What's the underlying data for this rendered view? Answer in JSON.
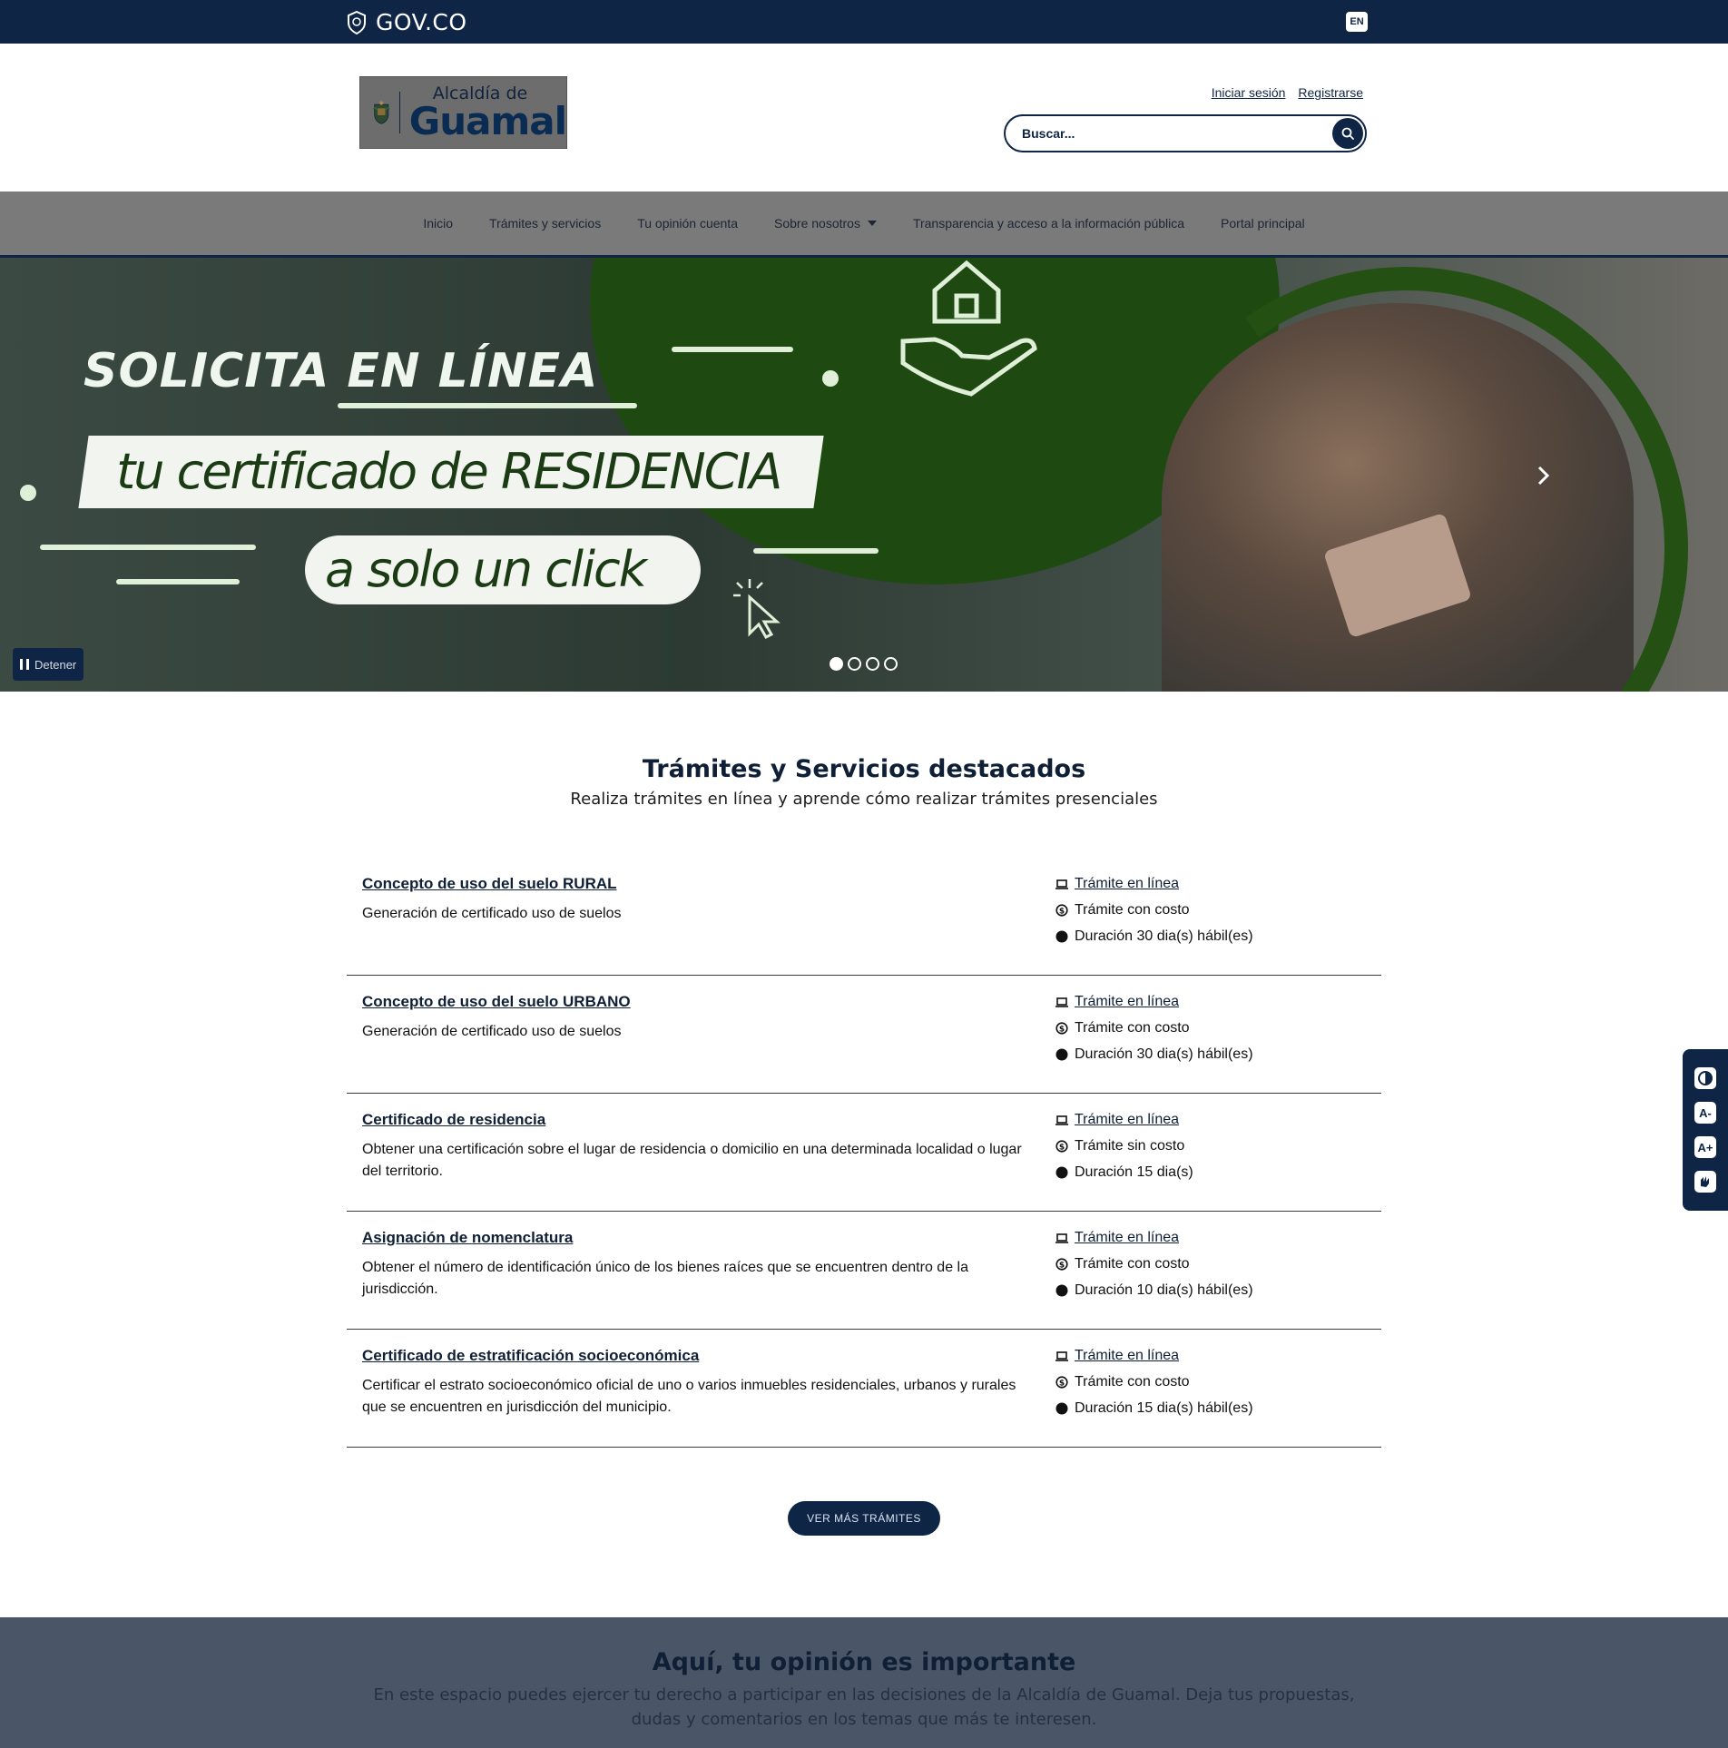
{
  "govbar": {
    "logo_text": "GOV.CO",
    "lang": "EN"
  },
  "header": {
    "brand_line1": "Alcaldía de",
    "brand_line2": "Guamal",
    "login": "Iniciar sesión",
    "register": "Registrarse",
    "search_placeholder": "Buscar..."
  },
  "nav": {
    "items": [
      "Inicio",
      "Trámites y servicios",
      "Tu opinión cuenta",
      "Sobre nosotros",
      "Transparencia y acceso a la información pública",
      "Portal principal"
    ]
  },
  "hero": {
    "title": "SOLICITA EN LÍNEA",
    "banner": "tu certificado de RESIDENCIA",
    "pill": "a solo un click",
    "stop_label": "Detener",
    "slides": 4,
    "active_slide": 1
  },
  "featured": {
    "title": "Trámites y Servicios destacados",
    "subtitle": "Realiza trámites en línea y aprende cómo realizar trámites presenciales",
    "items": [
      {
        "name": "Concepto de uso del suelo RURAL",
        "desc": "Generación de certificado uso de suelos",
        "mode": "Trámite en línea",
        "cost": "Trámite con costo",
        "duration": "Duración 30 dia(s) hábil(es)"
      },
      {
        "name": "Concepto de uso del suelo URBANO",
        "desc": "Generación de certificado uso de suelos",
        "mode": "Trámite en línea",
        "cost": "Trámite con costo",
        "duration": "Duración 30 dia(s) hábil(es)"
      },
      {
        "name": "Certificado de residencia",
        "desc": "Obtener una certificación sobre el lugar de residencia o domicilio en una determinada localidad o lugar del territorio.",
        "mode": "Trámite en línea",
        "cost": "Trámite sin costo",
        "duration": "Duración 15 dia(s)"
      },
      {
        "name": "Asignación de nomenclatura",
        "desc": "Obtener el número de identificación único de los bienes raíces que se encuentren dentro de la jurisdicción.",
        "mode": "Trámite en línea",
        "cost": "Trámite con costo",
        "duration": "Duración 10 dia(s) hábil(es)"
      },
      {
        "name": "Certificado de estratificación socioeconómica",
        "desc": "Certificar el estrato socioeconómico oficial de uno o varios inmuebles residenciales, urbanos y rurales que se encuentren en jurisdicción del municipio.",
        "mode": "Trámite en línea",
        "cost": "Trámite con costo",
        "duration": "Duración 15 dia(s) hábil(es)"
      }
    ],
    "more_button": "VER MÁS TRÁMITES"
  },
  "opinion": {
    "title": "Aquí, tu opinión es importante",
    "text": "En este espacio puedes ejercer tu derecho a participar en las decisiones de la Alcaldía de Guamal. Deja tus propuestas, dudas y comentarios en los temas que más te interesen."
  },
  "colors": {
    "primary": "#0f2545",
    "hero_green": "#1e4a12",
    "nav_bg": "#7a7a7a",
    "opinion_bg": "#4b5568"
  }
}
